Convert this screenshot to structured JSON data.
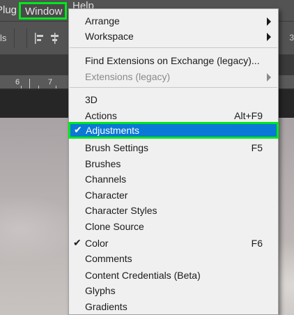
{
  "menubar": {
    "plugins_label": "Plugins",
    "window_label": "Window",
    "help_label": "Help"
  },
  "optionsbar": {
    "left_text": "ls",
    "right_text": "3"
  },
  "ruler": {
    "labels": [
      "6",
      "7"
    ]
  },
  "window_menu": {
    "items": [
      {
        "label": "Arrange",
        "submenu": true
      },
      {
        "label": "Workspace",
        "submenu": true
      },
      {
        "label": "Find Extensions on Exchange (legacy)..."
      },
      {
        "label": "Extensions (legacy)",
        "submenu": true,
        "disabled": true
      },
      {
        "label": "3D"
      },
      {
        "label": "Actions",
        "shortcut": "Alt+F9"
      },
      {
        "label": "Adjustments",
        "checked": true,
        "selected": true
      },
      {
        "label": "Brush Settings",
        "shortcut": "F5"
      },
      {
        "label": "Brushes"
      },
      {
        "label": "Channels"
      },
      {
        "label": "Character"
      },
      {
        "label": "Character Styles"
      },
      {
        "label": "Clone Source"
      },
      {
        "label": "Color",
        "checked": true,
        "shortcut": "F6"
      },
      {
        "label": "Comments"
      },
      {
        "label": "Content Credentials (Beta)"
      },
      {
        "label": "Glyphs"
      },
      {
        "label": "Gradients"
      }
    ]
  },
  "colors": {
    "highlight": "#0a78d7",
    "outline": "#00e81c",
    "menu_bg": "#f0f0f0",
    "chrome": "#535353"
  },
  "icons": {
    "check": "checkmark-icon",
    "submenu": "submenu-arrow-icon"
  }
}
